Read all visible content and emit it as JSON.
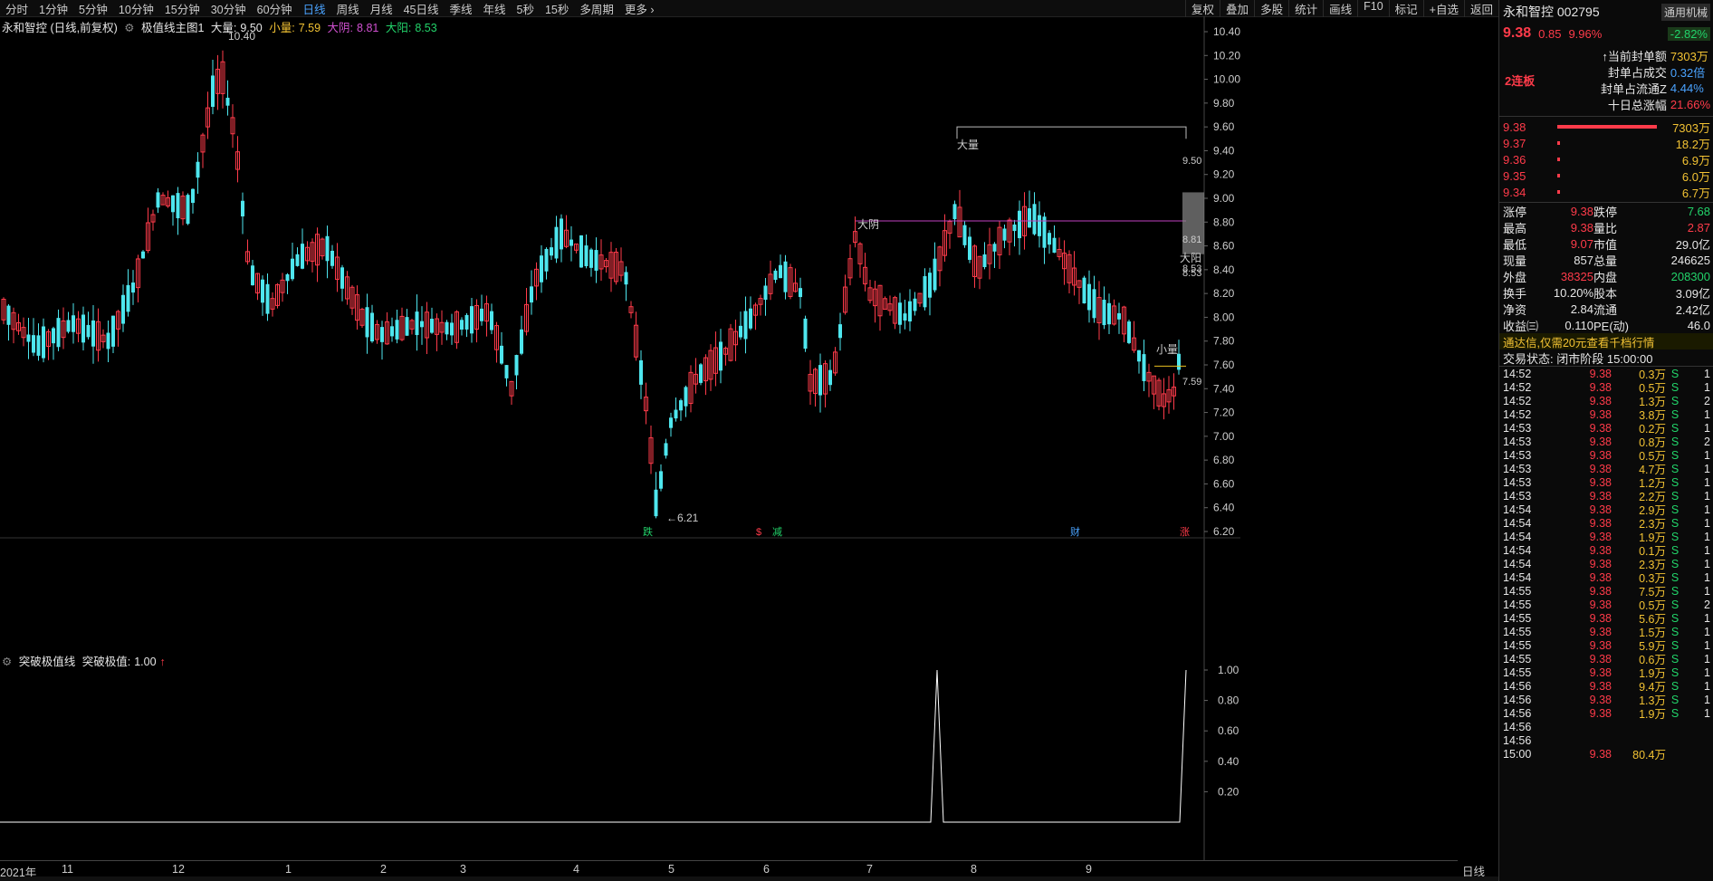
{
  "toolbar": {
    "periods": [
      "分时",
      "1分钟",
      "5分钟",
      "10分钟",
      "15分钟",
      "30分钟",
      "60分钟",
      "日线",
      "周线",
      "月线",
      "45日线",
      "季线",
      "年线",
      "5秒",
      "15秒",
      "多周期",
      "更多 ›"
    ],
    "active_period": "日线",
    "right_buttons": [
      "复权",
      "叠加",
      "多股",
      "统计",
      "画线",
      "F10",
      "标记",
      "+自选",
      "返回"
    ]
  },
  "main_legend": {
    "stock": "永和智控 (日线,前复权)",
    "indicator": "极值线主图1",
    "big_vol_label": "大量:",
    "big_vol": "9.50",
    "small_vol_label": "小量:",
    "small_vol": "7.59",
    "big_yin_label": "大阴:",
    "big_yin": "8.81",
    "big_yang_label": "大阳:",
    "big_yang": "8.53"
  },
  "ind_legend": {
    "name": "突破极值线",
    "value_label": "突破极值:",
    "value": "1.00"
  },
  "chart_annotations": {
    "high": "10.40",
    "low": "6.21",
    "big_vol_tag": "大量",
    "big_yin_tag": "大阴",
    "big_yang_tag": "大阳",
    "small_vol_tag": "小量",
    "right_labels": [
      "9.50",
      "8.81",
      "8.53",
      "8.53",
      "7.59"
    ],
    "bottom_tags": [
      "跌",
      "$",
      "减",
      "财",
      "涨"
    ]
  },
  "y_axis_main": [
    "10.40",
    "10.20",
    "10.00",
    "9.80",
    "9.60",
    "9.40",
    "9.20",
    "9.00",
    "8.80",
    "8.60",
    "8.40",
    "8.20",
    "8.00",
    "7.80",
    "7.60",
    "7.40",
    "7.20",
    "7.00",
    "6.80",
    "6.60",
    "6.40",
    "6.20"
  ],
  "y_axis_ind": [
    "1.00",
    "0.80",
    "0.60",
    "0.40",
    "0.20"
  ],
  "x_axis": [
    "2021年",
    "11",
    "12",
    "1",
    "2",
    "3",
    "4",
    "5",
    "6",
    "7",
    "8",
    "9"
  ],
  "x_axis_right": "日线",
  "panel": {
    "name": "永和智控 002795",
    "tag": "通用机械",
    "price": "9.38",
    "change": "0.85",
    "change_pct": "9.96%",
    "tag_change": "-2.82%",
    "limit_tag": "2连板",
    "seal_rows": [
      {
        "label": "当前封单额",
        "value": "7303万"
      },
      {
        "label": "封单占成交",
        "value": "0.32倍"
      },
      {
        "label": "封单占流通Z",
        "value": "4.44%"
      },
      {
        "label": "十日总涨幅",
        "value": "21.66%"
      }
    ],
    "bids": [
      {
        "price": "9.38",
        "vol": "7303万"
      },
      {
        "price": "9.37",
        "vol": "18.2万"
      },
      {
        "price": "9.36",
        "vol": "6.9万"
      },
      {
        "price": "9.35",
        "vol": "6.0万"
      },
      {
        "price": "9.34",
        "vol": "6.7万"
      }
    ],
    "stats": [
      [
        "涨停",
        "9.38",
        "跌停",
        "7.68"
      ],
      [
        "最高",
        "9.38",
        "量比",
        "2.87"
      ],
      [
        "最低",
        "9.07",
        "市值",
        "29.0亿"
      ],
      [
        "现量",
        "857",
        "总量",
        "246625"
      ],
      [
        "外盘",
        "38325",
        "内盘",
        "208300"
      ],
      [
        "换手",
        "10.20%",
        "股本",
        "3.09亿"
      ],
      [
        "净资",
        "2.84",
        "流通",
        "2.42亿"
      ],
      [
        "收益㈢",
        "0.110",
        "PE(动)",
        "46.0"
      ]
    ],
    "notice": "通达信,仅需20元查看千档行情",
    "status": "交易状态: 闭市阶段 15:00:00",
    "ticks": [
      [
        "14:52",
        "9.38",
        "0.3万",
        "S",
        "1"
      ],
      [
        "14:52",
        "9.38",
        "0.5万",
        "S",
        "1"
      ],
      [
        "14:52",
        "9.38",
        "1.3万",
        "S",
        "2"
      ],
      [
        "14:52",
        "9.38",
        "3.8万",
        "S",
        "1"
      ],
      [
        "14:53",
        "9.38",
        "0.2万",
        "S",
        "1"
      ],
      [
        "14:53",
        "9.38",
        "0.8万",
        "S",
        "2"
      ],
      [
        "14:53",
        "9.38",
        "0.5万",
        "S",
        "1"
      ],
      [
        "14:53",
        "9.38",
        "4.7万",
        "S",
        "1"
      ],
      [
        "14:53",
        "9.38",
        "1.2万",
        "S",
        "1"
      ],
      [
        "14:53",
        "9.38",
        "2.2万",
        "S",
        "1"
      ],
      [
        "14:54",
        "9.38",
        "2.9万",
        "S",
        "1"
      ],
      [
        "14:54",
        "9.38",
        "2.3万",
        "S",
        "1"
      ],
      [
        "14:54",
        "9.38",
        "1.9万",
        "S",
        "1"
      ],
      [
        "14:54",
        "9.38",
        "0.1万",
        "S",
        "1"
      ],
      [
        "14:54",
        "9.38",
        "2.3万",
        "S",
        "1"
      ],
      [
        "14:54",
        "9.38",
        "0.3万",
        "S",
        "1"
      ],
      [
        "14:55",
        "9.38",
        "7.5万",
        "S",
        "1"
      ],
      [
        "14:55",
        "9.38",
        "0.5万",
        "S",
        "2"
      ],
      [
        "14:55",
        "9.38",
        "5.6万",
        "S",
        "1"
      ],
      [
        "14:55",
        "9.38",
        "1.5万",
        "S",
        "1"
      ],
      [
        "14:55",
        "9.38",
        "5.9万",
        "S",
        "1"
      ],
      [
        "14:55",
        "9.38",
        "0.6万",
        "S",
        "1"
      ],
      [
        "14:55",
        "9.38",
        "1.9万",
        "S",
        "1"
      ],
      [
        "14:56",
        "9.38",
        "9.4万",
        "S",
        "1"
      ],
      [
        "14:56",
        "9.38",
        "1.3万",
        "S",
        "1"
      ],
      [
        "14:56",
        "9.38",
        "1.9万",
        "S",
        "1"
      ],
      [
        "14:56",
        "",
        "",
        "",
        ""
      ],
      [
        "14:56",
        "",
        "",
        "",
        ""
      ],
      [
        "15:00",
        "9.38",
        "80.4万",
        "",
        ""
      ]
    ]
  },
  "colors": {
    "up": "#ff3b4a",
    "down": "#4ee6ee",
    "yin_line": "#c040c0",
    "small_line": "#e8c020",
    "bg": "#000000"
  }
}
